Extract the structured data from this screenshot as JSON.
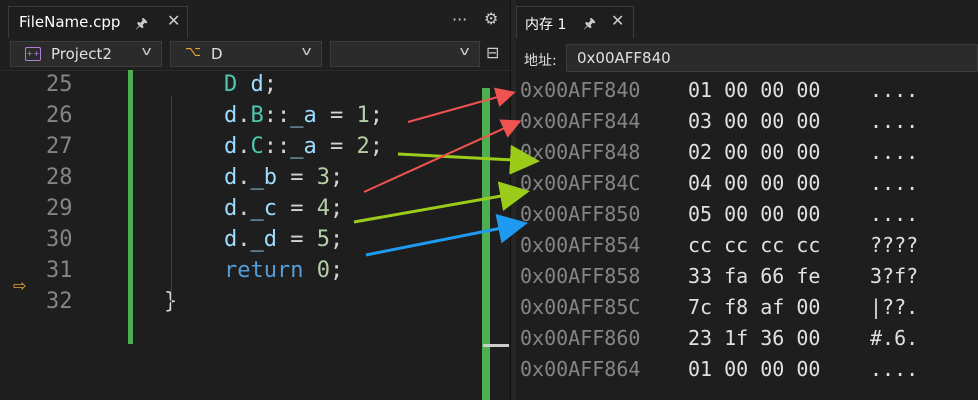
{
  "editor": {
    "tab": {
      "title": "FileName.cpp",
      "pin_icon": "pin-icon",
      "close_icon": "close-icon"
    },
    "toolbar": {
      "more_label": "···"
    },
    "nav": {
      "project": "Project2",
      "class": "D",
      "member": ""
    },
    "lines": [
      {
        "num": "25",
        "tokens": [
          [
            "ty",
            "D"
          ],
          [
            "op",
            " "
          ],
          [
            "va",
            "d"
          ],
          [
            "op",
            ";"
          ]
        ]
      },
      {
        "num": "26",
        "tokens": [
          [
            "va",
            "d"
          ],
          [
            "op",
            "."
          ],
          [
            "ty",
            "B"
          ],
          [
            "op",
            "::"
          ],
          [
            "va",
            "_a"
          ],
          [
            "op",
            " = "
          ],
          [
            "nu",
            "1"
          ],
          [
            "op",
            ";"
          ]
        ]
      },
      {
        "num": "27",
        "tokens": [
          [
            "va",
            "d"
          ],
          [
            "op",
            "."
          ],
          [
            "ty",
            "C"
          ],
          [
            "op",
            "::"
          ],
          [
            "va",
            "_a"
          ],
          [
            "op",
            " = "
          ],
          [
            "nu",
            "2"
          ],
          [
            "op",
            ";"
          ]
        ]
      },
      {
        "num": "28",
        "tokens": [
          [
            "va",
            "d"
          ],
          [
            "op",
            "."
          ],
          [
            "va",
            "_b"
          ],
          [
            "op",
            " = "
          ],
          [
            "nu",
            "3"
          ],
          [
            "op",
            ";"
          ]
        ]
      },
      {
        "num": "29",
        "tokens": [
          [
            "va",
            "d"
          ],
          [
            "op",
            "."
          ],
          [
            "va",
            "_c"
          ],
          [
            "op",
            " = "
          ],
          [
            "nu",
            "4"
          ],
          [
            "op",
            ";"
          ]
        ]
      },
      {
        "num": "30",
        "tokens": [
          [
            "va",
            "d"
          ],
          [
            "op",
            "."
          ],
          [
            "va",
            "_d"
          ],
          [
            "op",
            " = "
          ],
          [
            "nu",
            "5"
          ],
          [
            "op",
            ";"
          ]
        ]
      },
      {
        "num": "31",
        "tokens": [
          [
            "kw",
            "return"
          ],
          [
            "op",
            " "
          ],
          [
            "nu",
            "0"
          ],
          [
            "op",
            ";"
          ]
        ]
      },
      {
        "num": "32",
        "tokens": [
          [
            "op",
            "}"
          ]
        ]
      }
    ]
  },
  "memory": {
    "tab": {
      "title": "内存 1"
    },
    "address_label": "地址:",
    "address_value": "0x00AFF840",
    "rows": [
      {
        "addr": "0x00AFF840",
        "bytes": "01 00 00 00",
        "ascii": "...."
      },
      {
        "addr": "0x00AFF844",
        "bytes": "03 00 00 00",
        "ascii": "...."
      },
      {
        "addr": "0x00AFF848",
        "bytes": "02 00 00 00",
        "ascii": "...."
      },
      {
        "addr": "0x00AFF84C",
        "bytes": "04 00 00 00",
        "ascii": "...."
      },
      {
        "addr": "0x00AFF850",
        "bytes": "05 00 00 00",
        "ascii": "...."
      },
      {
        "addr": "0x00AFF854",
        "bytes": "cc cc cc cc",
        "ascii": "????"
      },
      {
        "addr": "0x00AFF858",
        "bytes": "33 fa 66 fe",
        "ascii": "3?f?"
      },
      {
        "addr": "0x00AFF85C",
        "bytes": "7c f8 af 00",
        "ascii": "|??."
      },
      {
        "addr": "0x00AFF860",
        "bytes": "23 1f 36 00",
        "ascii": "#.6."
      },
      {
        "addr": "0x00AFF864",
        "bytes": "01 00 00 00",
        "ascii": "...."
      }
    ]
  },
  "annotations": {
    "colors": {
      "red": "#ef5350",
      "green": "#9ccc1a",
      "blue": "#1e9bf0"
    }
  }
}
